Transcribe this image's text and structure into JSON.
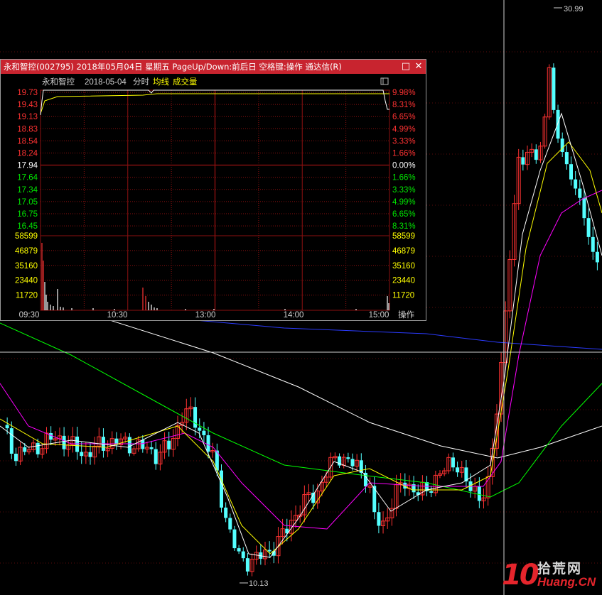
{
  "main": {
    "high_label": "30.99",
    "low_label": "10.13",
    "colors": {
      "up": "#ff3232",
      "down": "#54ffff",
      "ma5": "#ffffff",
      "ma10": "#ffff00",
      "ma20": "#ff00ff",
      "ma60": "#00ff00",
      "ma120": "#ffffff",
      "ma250": "#2b3bff"
    }
  },
  "popup": {
    "title": "永和智控(002795) 2018年05月04日 星期五 PageUp/Down:前后日 空格键:操作 通达信(R)",
    "header": {
      "stock": "永和智控",
      "date": "2018-05-04",
      "mode": "分时",
      "avg_label": "均线",
      "vol_label": "成交量"
    },
    "price_ticks": [
      "19.73",
      "19.43",
      "19.13",
      "18.83",
      "18.54",
      "18.24",
      "17.94",
      "17.64",
      "17.34",
      "17.05",
      "16.75",
      "16.45"
    ],
    "pct_ticks": [
      "9.98%",
      "8.31%",
      "6.65%",
      "4.99%",
      "3.33%",
      "1.66%",
      "0.00%",
      "1.66%",
      "3.33%",
      "4.99%",
      "6.65%",
      "8.31%"
    ],
    "vol_ticks": [
      "58599",
      "46879",
      "35160",
      "23440",
      "11720"
    ],
    "time_ticks": [
      "09:30",
      "10:30",
      "13:00",
      "14:00",
      "15:00"
    ],
    "op_label": "操作",
    "colors": {
      "price": "#ffffff",
      "avg": "#ffff00",
      "grid": "#8c1010",
      "up": "#ff3232",
      "down": "#00e600",
      "flat": "#ffffff"
    }
  },
  "watermark": {
    "logo": "10",
    "cn": "拾荒网",
    "en": "Huang.CN"
  }
}
